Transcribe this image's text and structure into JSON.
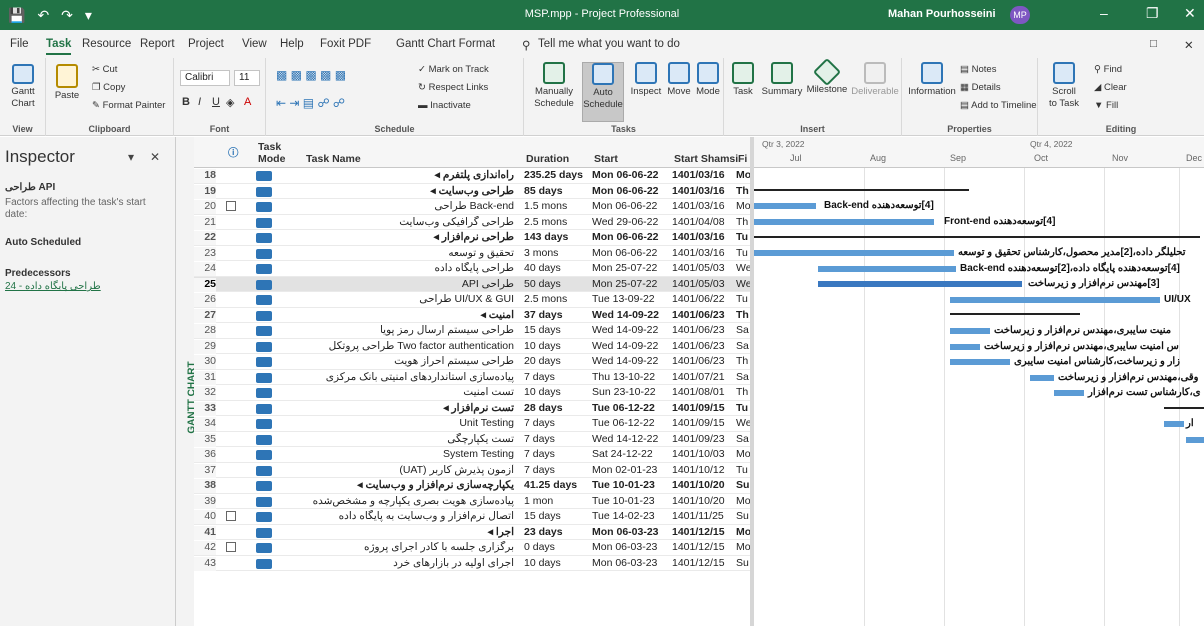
{
  "titlebar": {
    "file": "MSP.mpp",
    "sep": "-",
    "app": "Project Professional",
    "user": "Mahan Pourhosseini",
    "initials": "MP"
  },
  "menu": [
    "File",
    "Task",
    "Resource",
    "Report",
    "Project",
    "View",
    "Help",
    "Foxit PDF",
    "Gantt Chart Format"
  ],
  "search_placeholder": "Tell me what you want to do",
  "ribbon": {
    "view": {
      "gantt": "Gantt",
      "chart": "Chart",
      "label": "View"
    },
    "clipboard": {
      "paste": "Paste",
      "cut": "Cut",
      "copy": "Copy",
      "format_painter": "Format Painter",
      "label": "Clipboard"
    },
    "font": {
      "name": "Calibri",
      "size": "11",
      "label": "Font"
    },
    "schedule": {
      "mark_on_track": "Mark on Track",
      "respect_links": "Respect Links",
      "inactivate": "Inactivate",
      "label": "Schedule"
    },
    "tasks": {
      "manually": "Manually",
      "schedule1": "Schedule",
      "auto": "Auto",
      "schedule2": "Schedule",
      "inspect": "Inspect",
      "move": "Move",
      "mode": "Mode",
      "label": "Tasks"
    },
    "insert": {
      "task": "Task",
      "summary": "Summary",
      "milestone": "Milestone",
      "deliverable": "Deliverable",
      "label": "Insert"
    },
    "properties": {
      "information": "Information",
      "notes": "Notes",
      "details": "Details",
      "add_timeline": "Add to Timeline",
      "label": "Properties"
    },
    "editing": {
      "scroll": "Scroll",
      "to_task": "to Task",
      "find": "Find",
      "clear": "Clear",
      "fill": "Fill",
      "label": "Editing"
    }
  },
  "inspector": {
    "title": "Inspector",
    "task_name": "طراحی API",
    "factors": "Factors affecting the task's start",
    "date": "date:",
    "auto_scheduled": "Auto Scheduled",
    "predecessors": "Predecessors",
    "pred_link": "24 - طراحی پایگاه داده",
    "side_label": "GANTT CHART"
  },
  "grid": {
    "headers": {
      "task": "Task",
      "mode": "Mode",
      "name": "Task Name",
      "duration": "Duration",
      "start": "Start",
      "shamsi": "Start Shamsi",
      "fi": "Fi"
    },
    "rows": [
      {
        "id": "18",
        "name": "راه‌اندازی پلتفرم ◂",
        "dur": "235.25 days",
        "start": "Mon 06-06-22",
        "sh": "1401/03/16",
        "fi": "Mo",
        "sum": true
      },
      {
        "id": "19",
        "name": "طراحی وب‌سایت ◂",
        "dur": "85 days",
        "start": "Mon 06-06-22",
        "sh": "1401/03/16",
        "fi": "Th",
        "sum": true
      },
      {
        "id": "20",
        "name": "Back-end طراحی",
        "dur": "1.5 mons",
        "start": "Mon 06-06-22",
        "sh": "1401/03/16",
        "fi": "Mo",
        "cal": true
      },
      {
        "id": "21",
        "name": "طراحی گرافیکی وب‌سایت",
        "dur": "2.5 mons",
        "start": "Wed 29-06-22",
        "sh": "1401/04/08",
        "fi": "Th"
      },
      {
        "id": "22",
        "name": "طراحی نرم‌افزار ◂",
        "dur": "143 days",
        "start": "Mon 06-06-22",
        "sh": "1401/03/16",
        "fi": "Tu",
        "sum": true
      },
      {
        "id": "23",
        "name": "تحقیق و توسعه",
        "dur": "3 mons",
        "start": "Mon 06-06-22",
        "sh": "1401/03/16",
        "fi": "Tu"
      },
      {
        "id": "24",
        "name": "طراحی پایگاه داده",
        "dur": "40 days",
        "start": "Mon 25-07-22",
        "sh": "1401/05/03",
        "fi": "We"
      },
      {
        "id": "25",
        "name": "طراحی API",
        "dur": "50 days",
        "start": "Mon 25-07-22",
        "sh": "1401/05/03",
        "fi": "We",
        "selected": true
      },
      {
        "id": "26",
        "name": "UI/UX & GUI طراحی",
        "dur": "2.5 mons",
        "start": "Tue 13-09-22",
        "sh": "1401/06/22",
        "fi": "Tu"
      },
      {
        "id": "27",
        "name": "امنیت ◂",
        "dur": "37 days",
        "start": "Wed 14-09-22",
        "sh": "1401/06/23",
        "fi": "Th",
        "sum": true
      },
      {
        "id": "28",
        "name": "طراحی سیستم ارسال رمز پویا",
        "dur": "15 days",
        "start": "Wed 14-09-22",
        "sh": "1401/06/23",
        "fi": "Sa"
      },
      {
        "id": "29",
        "name": "Two factor authentication طراحی پروتکل",
        "dur": "10 days",
        "start": "Wed 14-09-22",
        "sh": "1401/06/23",
        "fi": "Sa"
      },
      {
        "id": "30",
        "name": "طراحی سیستم احراز هویت",
        "dur": "20 days",
        "start": "Wed 14-09-22",
        "sh": "1401/06/23",
        "fi": "Th"
      },
      {
        "id": "31",
        "name": "پیاده‌سازی استانداردهای امنیتی بانک مرکزی",
        "dur": "7 days",
        "start": "Thu 13-10-22",
        "sh": "1401/07/21",
        "fi": "Sa"
      },
      {
        "id": "32",
        "name": "تست امنیت",
        "dur": "10 days",
        "start": "Sun 23-10-22",
        "sh": "1401/08/01",
        "fi": "Th"
      },
      {
        "id": "33",
        "name": "تست نرم‌افزار ◂",
        "dur": "28 days",
        "start": "Tue 06-12-22",
        "sh": "1401/09/15",
        "fi": "Tu",
        "sum": true
      },
      {
        "id": "34",
        "name": "Unit Testing",
        "dur": "7 days",
        "start": "Tue 06-12-22",
        "sh": "1401/09/15",
        "fi": "We"
      },
      {
        "id": "35",
        "name": "تست یکپارچگی",
        "dur": "7 days",
        "start": "Wed 14-12-22",
        "sh": "1401/09/23",
        "fi": "Sa"
      },
      {
        "id": "36",
        "name": "System Testing",
        "dur": "7 days",
        "start": "Sat 24-12-22",
        "sh": "1401/10/03",
        "fi": "Mo"
      },
      {
        "id": "37",
        "name": "آزمون پذیرش کاربر (UAT)",
        "dur": "7 days",
        "start": "Mon 02-01-23",
        "sh": "1401/10/12",
        "fi": "Tu"
      },
      {
        "id": "38",
        "name": "یکپارچه‌سازی نرم‌افزار و وب‌سایت ◂",
        "dur": "41.25 days",
        "start": "Tue 10-01-23",
        "sh": "1401/10/20",
        "fi": "Su",
        "sum": true
      },
      {
        "id": "39",
        "name": "پیاده‌سازی هویت بصری یکپارچه و مشخص‌شده",
        "dur": "1 mon",
        "start": "Tue 10-01-23",
        "sh": "1401/10/20",
        "fi": "Mo"
      },
      {
        "id": "40",
        "name": "اتصال نرم‌افزار و وب‌سایت به پایگاه داده",
        "dur": "15 days",
        "start": "Tue 14-02-23",
        "sh": "1401/11/25",
        "fi": "Su",
        "cal": true
      },
      {
        "id": "41",
        "name": "اجرا ◂",
        "dur": "23 days",
        "start": "Mon 06-03-23",
        "sh": "1401/12/15",
        "fi": "Mo",
        "sum": true
      },
      {
        "id": "42",
        "name": "برگزاری جلسه با کادر اجرای پروژه",
        "dur": "0 days",
        "start": "Mon 06-03-23",
        "sh": "1401/12/15",
        "fi": "Mo",
        "cal": true
      },
      {
        "id": "43",
        "name": "اجرای اولیه در بازارهای خرد",
        "dur": "10 days",
        "start": "Mon 06-03-23",
        "sh": "1401/12/15",
        "fi": "Su"
      }
    ]
  },
  "gantt": {
    "quarters": [
      "Qtr 3, 2022",
      "Qtr 4, 2022"
    ],
    "months": [
      "Jul",
      "Aug",
      "Sep",
      "Oct",
      "Nov",
      "Dec"
    ],
    "labels": [
      "[4]توسعه‌دهنده Back-end",
      "[4]توسعه‌دهنده Front-end",
      "تحلیلگر داده،[2]مدیر محصول،کارشناس تحقیق و توسعه",
      "[4]توسعه‌دهنده پایگاه داده،[2]توسعه‌دهنده Back-end",
      "[3]مهندس نرم‌افزار و زیرساخت",
      "UI/UX",
      "منیت سایبری،مهندس نرم‌افزار و زیرساخت",
      "س امنیت سایبری،مهندس نرم‌افزار و زیرساخت",
      "زار و زیرساخت،کارشناس امنیت سایبری",
      "وقی،مهندس نرم‌افزار و زیرساخت",
      "ی،کارشناس تست نرم‌افزار",
      "ار"
    ]
  },
  "colors": {
    "brand": "#217346",
    "bar": "#5b9bd5"
  }
}
